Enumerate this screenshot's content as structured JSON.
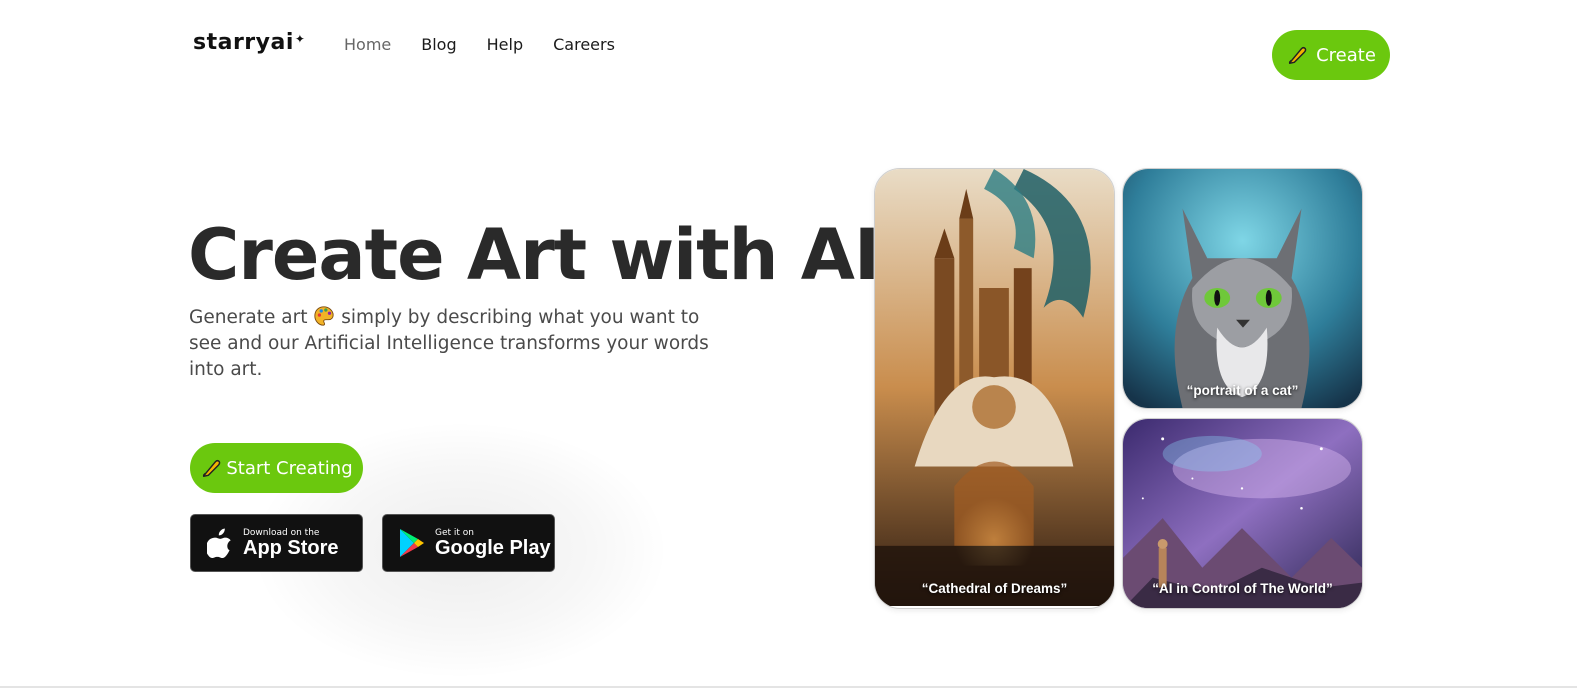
{
  "header": {
    "logo": "starryai",
    "nav": [
      {
        "label": "Home",
        "active": true
      },
      {
        "label": "Blog",
        "active": false
      },
      {
        "label": "Help",
        "active": false
      },
      {
        "label": "Careers",
        "active": false
      }
    ],
    "create_label": "Create"
  },
  "hero": {
    "title": "Create Art with AI",
    "subtitle_part1": "Generate art",
    "subtitle_part2": "simply by describing what you want to see and our Artificial Intelligence transforms your words into art.",
    "start_label": "Start Creating"
  },
  "stores": {
    "apple_small": "Download on the",
    "apple_big": "App Store",
    "google_small": "Get it on",
    "google_big": "Google Play"
  },
  "gallery": [
    {
      "caption": "“Cathedral of Dreams”"
    },
    {
      "caption": "“portrait of a cat”"
    },
    {
      "caption": "“AI in Control of The World”"
    }
  ],
  "colors": {
    "accent": "#6bc80e",
    "text_dark": "#2a2a2a",
    "store_bg": "#111111"
  },
  "icons": [
    "pen-icon",
    "palette-icon",
    "apple-icon",
    "google-play-icon"
  ]
}
